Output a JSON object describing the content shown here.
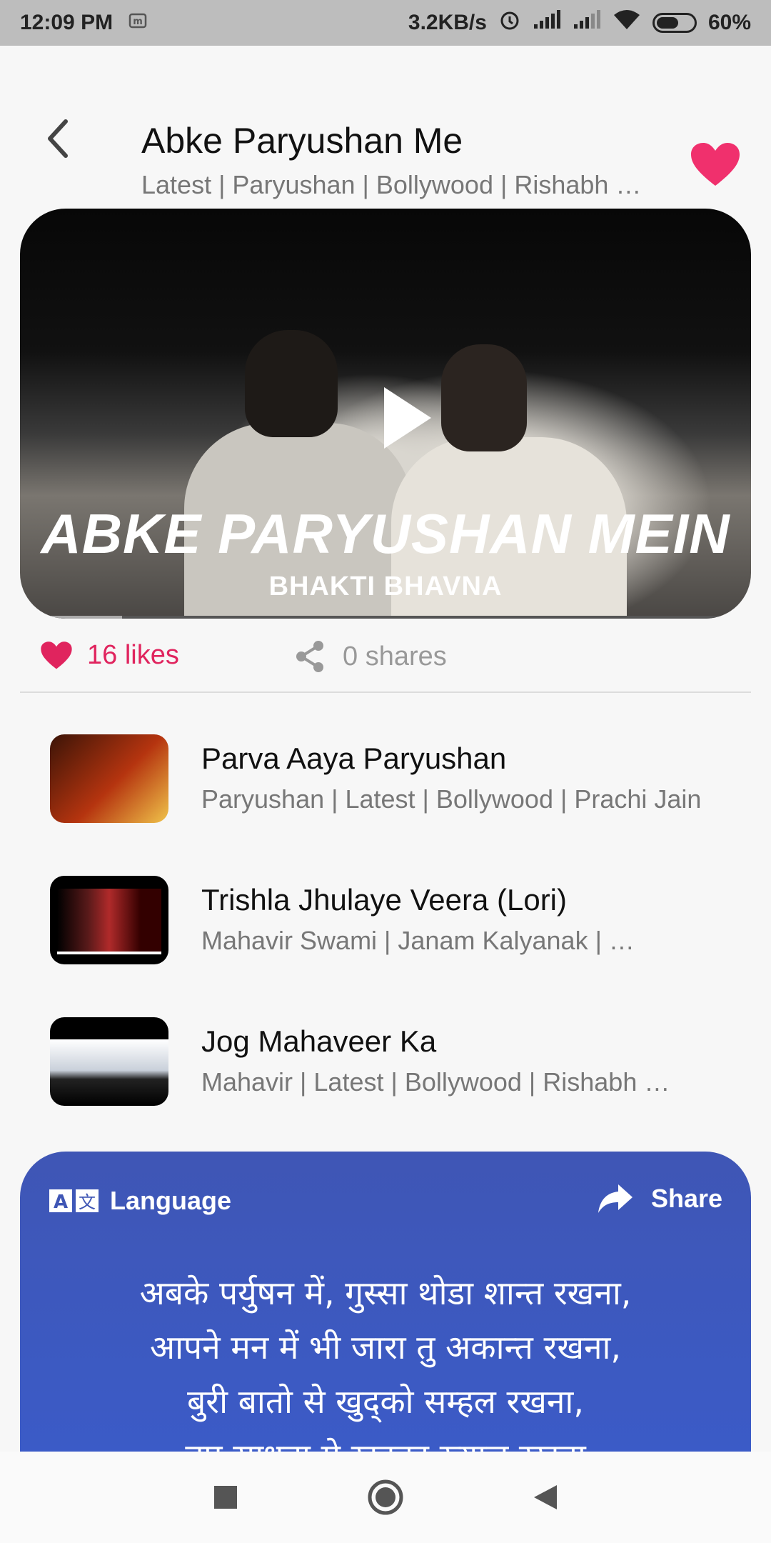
{
  "status_bar": {
    "time": "12:09 PM",
    "net_speed": "3.2KB/s",
    "battery": "60%"
  },
  "header": {
    "title": "Abke Paryushan Me",
    "subtitle": "Latest | Paryushan | Bollywood | Rishabh …"
  },
  "video": {
    "overlay_title": "ABKE PARYUSHAN MEIN",
    "overlay_subtitle": "BHAKTI BHAVNA",
    "progress_fraction": 0.14
  },
  "stats": {
    "likes": "16 likes",
    "shares": "0 shares"
  },
  "related": [
    {
      "title": "Parva Aaya Paryushan",
      "tags": "Paryushan | Latest | Bollywood | Prachi Jain"
    },
    {
      "title": "Trishla Jhulaye Veera (Lori)",
      "tags": "Mahavir Swami | Janam Kalyanak | …"
    },
    {
      "title": "Jog Mahaveer Ka",
      "tags": "Mahavir | Latest | Bollywood | Rishabh …"
    }
  ],
  "lyrics_card": {
    "language_label": "Language",
    "share_label": "Share",
    "lines": [
      "अबके पर्युषन में, गुस्सा थोडा शान्त रखना,",
      "आपने मन में भी जारा तु अकान्त रखना,",
      "बुरी बातो से खुद्को सम्हल रखना,",
      "तप साधना मे खुदका ख्याल रखना"
    ]
  },
  "colors": {
    "accent": "#e0245e",
    "card_blue": "#3f56b5"
  }
}
